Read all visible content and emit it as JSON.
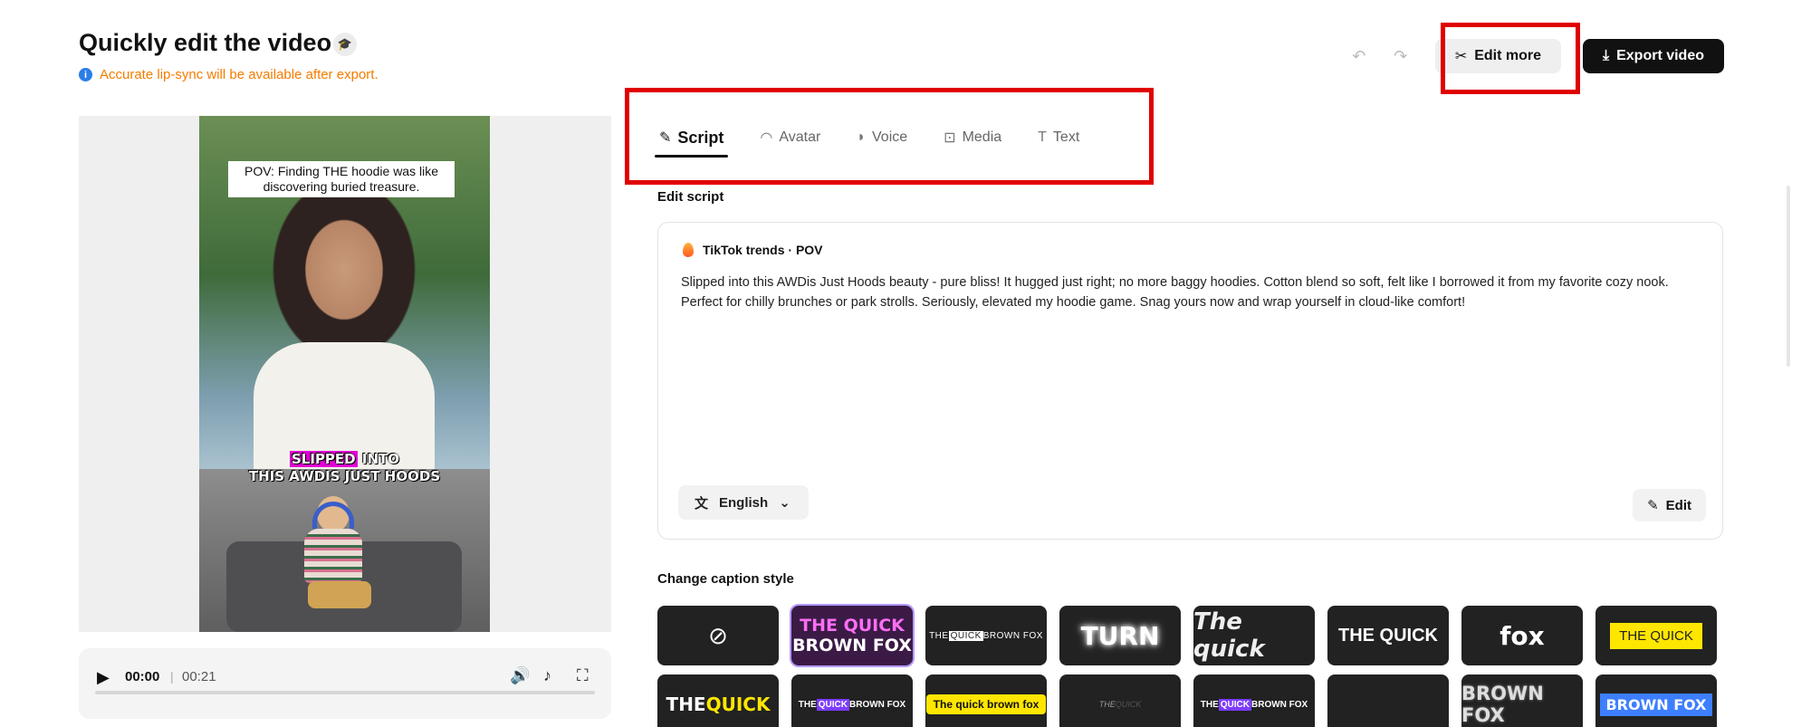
{
  "header": {
    "title": "Quickly edit the video",
    "notice": "Accurate lip-sync will be available after export.",
    "edit_more_label": "Edit more",
    "export_label": "Export video"
  },
  "preview": {
    "caption_top": "POV: Finding THE hoodie was like discovering buried treasure.",
    "caption_bottom_highlight": "SLIPPED",
    "caption_bottom_rest1": " INTO",
    "caption_bottom_line2": "THIS AWDIS JUST HOODS"
  },
  "player": {
    "current_time": "00:00",
    "separator": "|",
    "total_time": "00:21",
    "progress": 0
  },
  "tabs": [
    {
      "label": "Script",
      "icon": "script-icon",
      "active": true
    },
    {
      "label": "Avatar",
      "icon": "avatar-icon",
      "active": false
    },
    {
      "label": "Voice",
      "icon": "voice-icon",
      "active": false
    },
    {
      "label": "Media",
      "icon": "media-icon",
      "active": false
    },
    {
      "label": "Text",
      "icon": "text-icon",
      "active": false
    }
  ],
  "script": {
    "section_label": "Edit script",
    "tag": "TikTok trends · POV",
    "text": "Slipped into this AWDis Just Hoods beauty - pure bliss! It hugged just right; no more baggy hoodies. Cotton blend so soft, felt like I borrowed it from my favorite cozy nook. Perfect for chilly brunches or park strolls. Seriously, elevated my hoodie game. Snag yours now and wrap yourself in cloud-like comfort!",
    "language": "English",
    "edit_label": "Edit"
  },
  "caption_styles": {
    "section_label": "Change caption style",
    "row1": {
      "quick_brown_1": "THE QUICK",
      "quick_brown_2": "BROWN FOX",
      "tiny_a": "THE ",
      "tiny_mark": "QUICK",
      "tiny_b": " BROWN FOX",
      "turn": "TURN",
      "italic": "The quick",
      "thequick": "THE QUICK",
      "fox": "fox",
      "yellow_box": "THE QUICK"
    },
    "row2": {
      "tq_white": "THE ",
      "tq_yellow": "QUICK",
      "purple_a": "THE ",
      "purple_mark": "QUICK",
      "purple_b": " BROWN FOX",
      "yellow_pill": "The quick brown fox",
      "faint_a": "THE ",
      "faint_b": "QUICK",
      "purple2_a": "THE ",
      "purple2_mark": "QUICK",
      "purple2_b": " BROWN FOX",
      "brownfox": "BROWN FOX",
      "bluebox": "BROWN FOX"
    }
  },
  "colors": {
    "notice": "#f57c00",
    "highlight_box": "#e00000",
    "accent_purple": "#b49bff"
  }
}
